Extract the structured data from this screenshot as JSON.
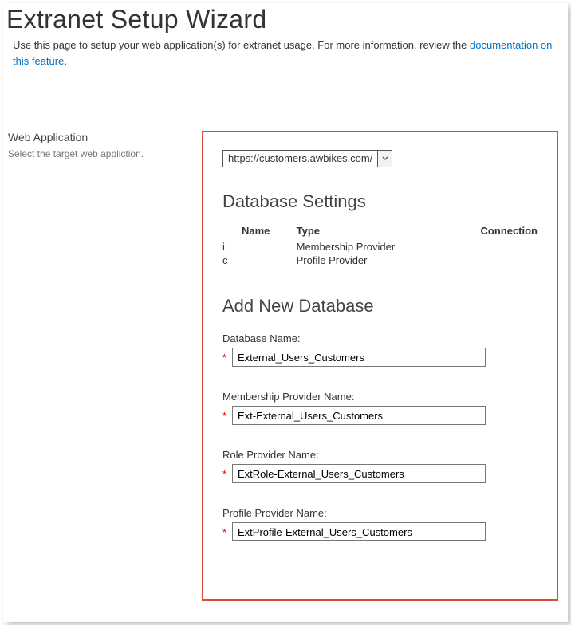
{
  "page": {
    "title": "Extranet Setup Wizard",
    "intro_text_pre": "Use this page to setup your web application(s) for extranet usage. For more information, review the ",
    "intro_link": "documentation on this feature",
    "intro_text_post": "."
  },
  "left": {
    "title": "Web Application",
    "desc": "Select the target web appliction."
  },
  "webapp": {
    "selected": "https://customers.awbikes.com/"
  },
  "db_settings": {
    "heading": "Database Settings",
    "headers": {
      "name": "Name",
      "type": "Type",
      "connection": "Connection"
    },
    "rows": [
      {
        "code": "i",
        "name": "",
        "type": "Membership Provider",
        "connection": ""
      },
      {
        "code": "c",
        "name": "",
        "type": "Profile Provider",
        "connection": ""
      }
    ]
  },
  "add_db": {
    "heading": "Add New Database",
    "required_indicator": "*",
    "fields": {
      "database_name": {
        "label": "Database Name:",
        "value": "External_Users_Customers"
      },
      "membership_provider": {
        "label": "Membership Provider Name:",
        "value": "Ext-External_Users_Customers"
      },
      "role_provider": {
        "label": "Role Provider Name:",
        "value": "ExtRole-External_Users_Customers"
      },
      "profile_provider": {
        "label": "Profile Provider Name:",
        "value": "ExtProfile-External_Users_Customers"
      }
    }
  }
}
